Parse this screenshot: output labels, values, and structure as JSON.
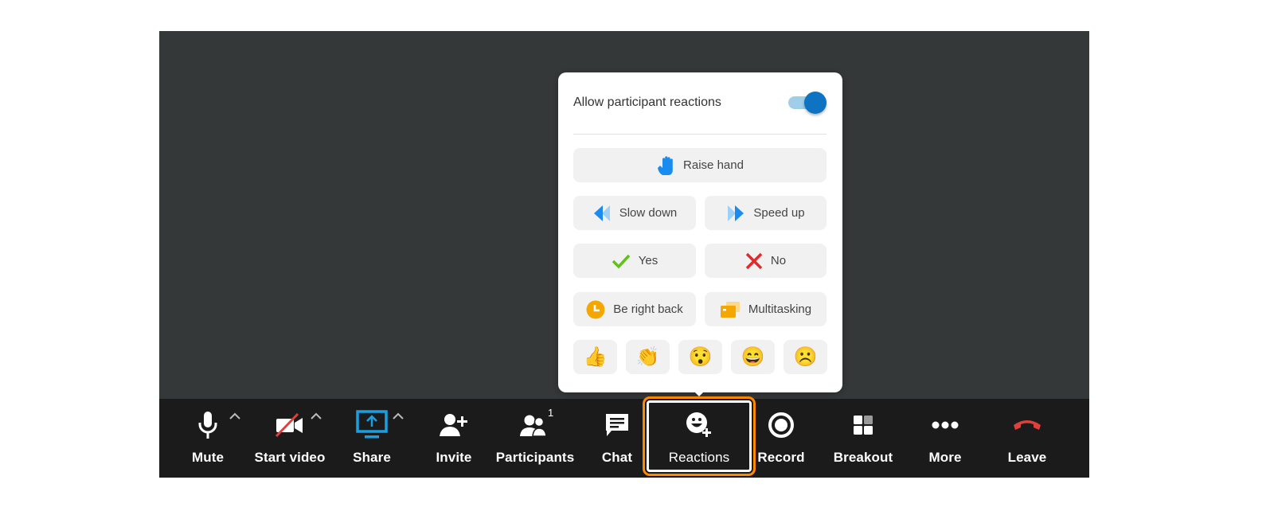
{
  "popup": {
    "allow_reactions_label": "Allow participant reactions",
    "allow_reactions_enabled": true,
    "buttons": {
      "raise_hand": "Raise hand",
      "slow_down": "Slow down",
      "speed_up": "Speed up",
      "yes": "Yes",
      "no": "No",
      "be_right_back": "Be right back",
      "multitasking": "Multitasking"
    },
    "emojis": [
      {
        "name": "thumbs-up",
        "glyph": "👍"
      },
      {
        "name": "clapping-hands",
        "glyph": "👏"
      },
      {
        "name": "surprised-face",
        "glyph": "😯"
      },
      {
        "name": "grinning-face",
        "glyph": "😄"
      },
      {
        "name": "frowning-face",
        "glyph": "☹️"
      }
    ]
  },
  "toolbar": {
    "items": [
      {
        "id": "mute",
        "label": "Mute",
        "icon": "microphone-icon"
      },
      {
        "id": "start-video",
        "label": "Start video",
        "icon": "video-off-icon"
      },
      {
        "id": "share",
        "label": "Share",
        "icon": "share-screen-icon"
      },
      {
        "id": "invite",
        "label": "Invite",
        "icon": "add-person-icon"
      },
      {
        "id": "participants",
        "label": "Participants",
        "icon": "participants-icon",
        "badge": "1"
      },
      {
        "id": "chat",
        "label": "Chat",
        "icon": "chat-icon"
      },
      {
        "id": "reactions",
        "label": "Reactions",
        "icon": "reactions-icon",
        "active": true
      },
      {
        "id": "record",
        "label": "Record",
        "icon": "record-icon"
      },
      {
        "id": "breakout",
        "label": "Breakout",
        "icon": "breakout-icon"
      },
      {
        "id": "more",
        "label": "More",
        "icon": "more-icon"
      },
      {
        "id": "leave",
        "label": "Leave",
        "icon": "leave-phone-icon"
      }
    ]
  },
  "colors": {
    "accent_blue": "#0e73c2",
    "share_blue": "#1aa0e0",
    "active_outline": "#ff8a00",
    "leave_red": "#e0403a",
    "yes_green": "#5fc21a",
    "no_red": "#e32a2a",
    "amber": "#f4a700"
  }
}
